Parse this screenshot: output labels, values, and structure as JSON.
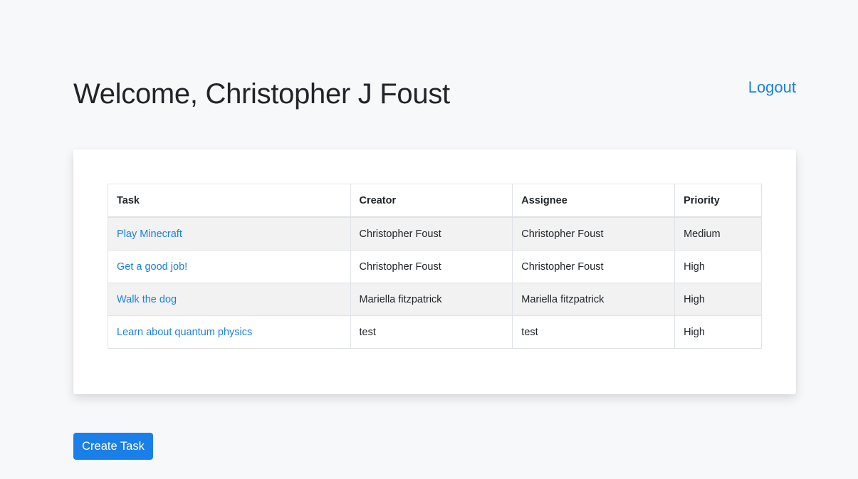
{
  "header": {
    "title": "Welcome, Christopher J Foust",
    "logout_label": "Logout"
  },
  "tasks_table": {
    "columns": [
      "Task",
      "Creator",
      "Assignee",
      "Priority"
    ],
    "rows": [
      {
        "task": "Play Minecraft",
        "creator": "Christopher Foust",
        "assignee": "Christopher Foust",
        "priority": "Medium"
      },
      {
        "task": "Get a good job!",
        "creator": "Christopher Foust",
        "assignee": "Christopher Foust",
        "priority": "High"
      },
      {
        "task": "Walk the dog",
        "creator": "Mariella fitzpatrick",
        "assignee": "Mariella fitzpatrick",
        "priority": "High"
      },
      {
        "task": "Learn about quantum physics",
        "creator": "test",
        "assignee": "test",
        "priority": "High"
      }
    ]
  },
  "actions": {
    "create_task_label": "Create Task"
  },
  "colors": {
    "accent": "#1a7fe8",
    "background": "#f7f8fa",
    "stripe": "#f2f2f2"
  }
}
